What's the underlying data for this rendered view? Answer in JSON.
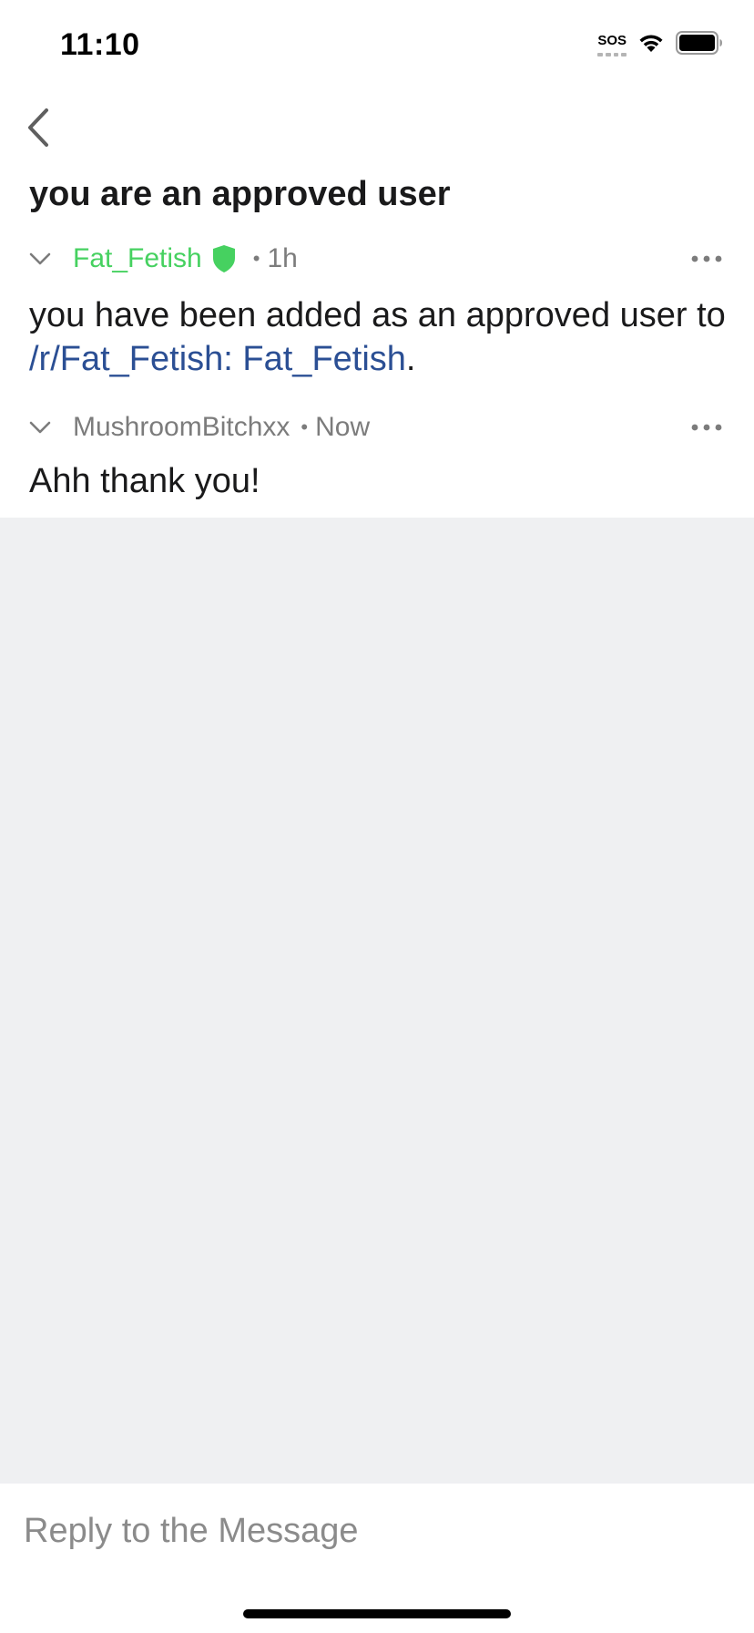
{
  "status_bar": {
    "time": "11:10",
    "sos_label": "SOS",
    "icons": [
      "sos-indicator",
      "wifi-icon",
      "battery-icon"
    ]
  },
  "nav": {
    "back_icon": "chevron-left-icon"
  },
  "thread": {
    "subject": "you are an approved user",
    "messages": [
      {
        "author": "Fat_Fetish",
        "author_role": "moderator",
        "author_color": "#46d160",
        "badge_icon": "shield-icon",
        "separator": "•",
        "time": "1h",
        "body_prefix": "you have been added as an approved user to ",
        "body_link": "/r/Fat_Fetish: Fat_Fetish",
        "body_suffix": "."
      },
      {
        "author": "MushroomBitchxx",
        "separator": "•",
        "time": "Now",
        "body": "Ahh thank you!"
      }
    ]
  },
  "reply": {
    "placeholder": "Reply to the Message",
    "value": ""
  },
  "colors": {
    "moderator_green": "#46d160",
    "link_blue": "#2b4f94",
    "background_gray": "#eff0f2"
  }
}
